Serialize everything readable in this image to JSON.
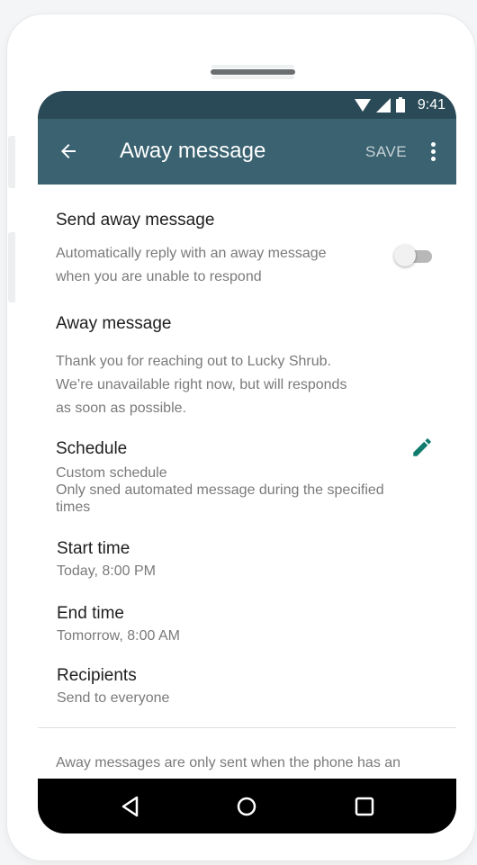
{
  "statusbar": {
    "time": "9:41"
  },
  "appbar": {
    "title": "Away message",
    "save_label": "SAVE"
  },
  "settings": {
    "send_away": {
      "title": "Send away message",
      "desc_line1": "Automatically reply with an away message",
      "desc_line2": "when you are unable to respond",
      "toggle_on": false
    },
    "away_message": {
      "title": "Away message",
      "text_line1": "Thank you for reaching out to Lucky Shrub.",
      "text_line2": "We’re unavailable right now, but will responds",
      "text_line3": "as soon as possible."
    },
    "schedule": {
      "title": "Schedule",
      "value": "Custom schedule",
      "desc_line1": "Only sned automated message during the specified",
      "desc_line2": "times"
    },
    "start_time": {
      "title": "Start time",
      "value": "Today, 8:00 PM"
    },
    "end_time": {
      "title": "End time",
      "value": "Tomorrow, 8:00 AM"
    },
    "recipients": {
      "title": "Recipients",
      "value": "Send to everyone"
    }
  },
  "footer": {
    "note": "Away messages are only sent when the phone has an"
  },
  "colors": {
    "statusbar": "#294a56",
    "appbar": "#3a6270",
    "accent": "#0f7c6d"
  },
  "icons": {
    "back": "arrow-left-icon",
    "more": "more-vert-icon",
    "edit": "pencil-icon",
    "wifi": "wifi-icon",
    "signal": "signal-icon",
    "battery": "battery-icon",
    "nav_back": "triangle-back-icon",
    "nav_home": "circle-home-icon",
    "nav_recents": "square-recents-icon"
  }
}
